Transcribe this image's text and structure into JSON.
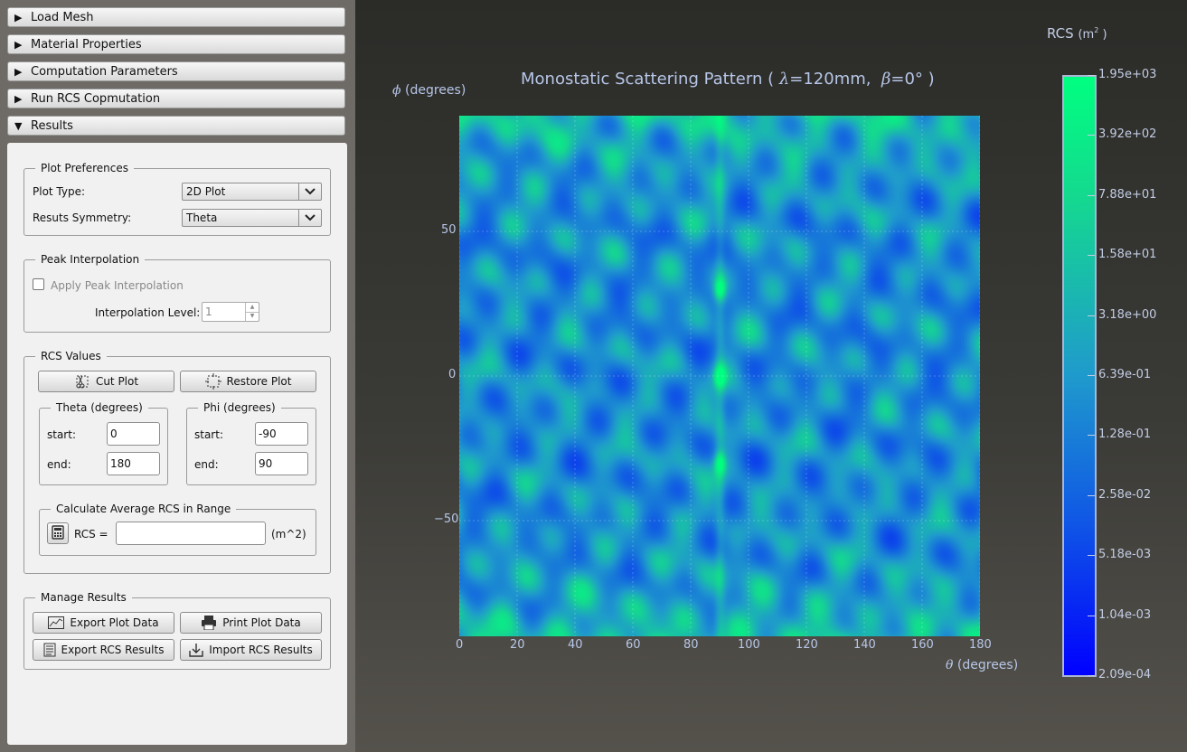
{
  "accordion": [
    {
      "label": "Load Mesh",
      "expanded": false
    },
    {
      "label": "Material Properties",
      "expanded": false
    },
    {
      "label": "Computation Parameters",
      "expanded": false
    },
    {
      "label": "Run RCS Copmutation",
      "expanded": false
    },
    {
      "label": "Results",
      "expanded": true
    }
  ],
  "plot_prefs": {
    "title": "Plot Preferences",
    "plot_type_label": "Plot Type:",
    "plot_type_value": "2D Plot",
    "symmetry_label": "Resuts Symmetry:",
    "symmetry_value": "Theta"
  },
  "peak": {
    "title": "Peak Interpolation",
    "checkbox_label": "Apply Peak Interpolation",
    "checked": false,
    "level_label": "Interpolation Level:",
    "level_value": "1"
  },
  "rcs_values": {
    "title": "RCS Values",
    "cut_plot": "Cut Plot",
    "restore_plot": "Restore Plot",
    "theta_title": "Theta (degrees)",
    "phi_title": "Phi (degrees)",
    "start_label": "start:",
    "end_label": "end:",
    "theta_start": "0",
    "theta_end": "180",
    "phi_start": "-90",
    "phi_end": "90",
    "avg_title": "Calculate Average RCS in Range",
    "rcs_label": "RCS =",
    "rcs_value": "",
    "rcs_unit": "(m^2)"
  },
  "manage": {
    "title": "Manage Results",
    "export_plot": "Export Plot Data",
    "print_plot": "Print Plot Data",
    "export_rcs": "Export RCS Results",
    "import_rcs": "Import RCS Results"
  },
  "plot": {
    "title_prefix": "Monostatic Scattering Pattern (",
    "lambda_sym": "λ",
    "lambda_val": "=120mm,",
    "beta_sym": "β",
    "beta_val": "=0°",
    "title_suffix": ")",
    "ylabel_sym": "ϕ",
    "ylabel": "(degrees)",
    "xlabel_sym": "θ",
    "xlabel": "(degrees)",
    "x_ticks": [
      "0",
      "20",
      "40",
      "60",
      "80",
      "100",
      "120",
      "140",
      "160",
      "180"
    ],
    "y_ticks": [
      "50",
      "0",
      "−50"
    ],
    "colorbar_title": "RCS",
    "colorbar_unit": "(m",
    "colorbar_unit_sup": "2",
    "colorbar_unit_end": ")",
    "colorbar_ticks": [
      "1.95e+03",
      "3.92e+02",
      "7.88e+01",
      "1.58e+01",
      "3.18e+00",
      "6.39e-01",
      "1.28e-01",
      "2.58e-02",
      "5.18e-03",
      "1.04e-03",
      "2.09e-04"
    ],
    "colors": {
      "low": "#0000ff",
      "mid": "#1f9acc",
      "high": "#00ff80",
      "axis_text": "#b7c7e8"
    }
  },
  "chart_data": {
    "type": "heatmap",
    "title": "Monostatic Scattering Pattern ( λ=120mm, β=0° )",
    "xlabel": "θ (degrees)",
    "ylabel": "ϕ (degrees)",
    "xlim": [
      0,
      180
    ],
    "ylim": [
      -90,
      90
    ],
    "x_ticks": [
      0,
      20,
      40,
      60,
      80,
      100,
      120,
      140,
      160,
      180
    ],
    "y_ticks": [
      -50,
      0,
      50
    ],
    "colorbar_label": "RCS (m²)",
    "colorbar_scale": "log",
    "colorbar_range": [
      0.000209,
      1950.0
    ],
    "grid": true,
    "annotations": [
      {
        "theta": 90,
        "phi": 30,
        "note": "local maximum"
      },
      {
        "theta": 90,
        "phi": 0,
        "note": "local maximum"
      },
      {
        "theta": 90,
        "phi": -30,
        "note": "local maximum"
      }
    ]
  }
}
